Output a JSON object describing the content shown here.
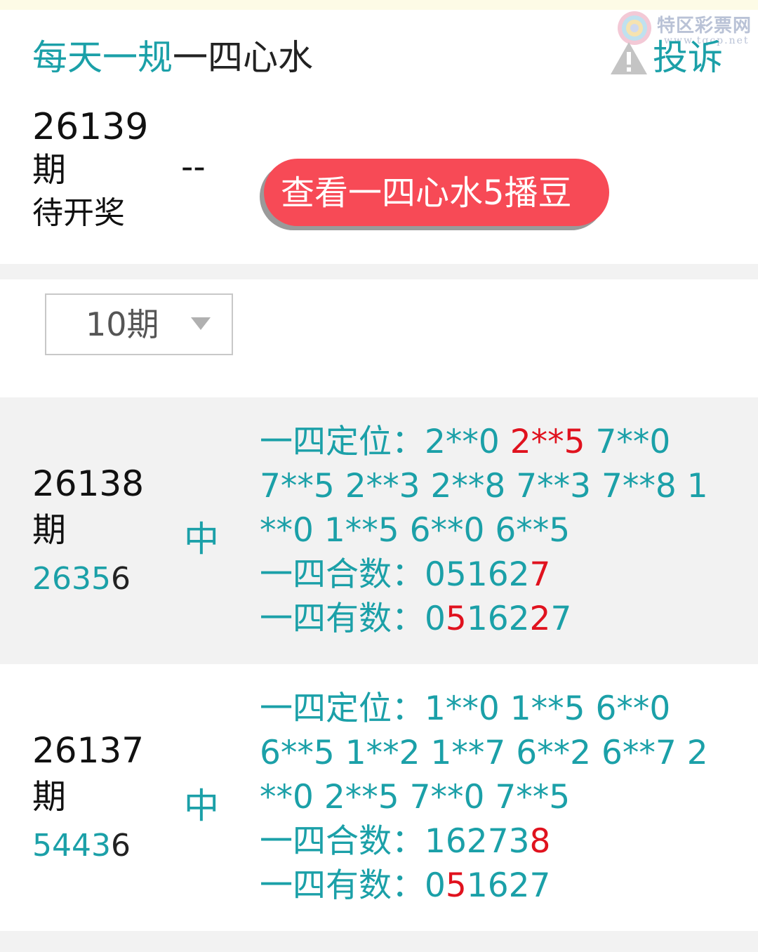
{
  "header": {
    "title_part1": "每天一规",
    "title_part2": "一四心水",
    "report_label": "投诉"
  },
  "watermark": {
    "name": "特区彩票网",
    "url": "www.tqcp.net"
  },
  "current": {
    "issue": "26139",
    "issue_unit": "期",
    "status": "待开奖",
    "result_placeholder": "--",
    "view_button": "查看一四心水5播豆"
  },
  "filter": {
    "selected": "10期"
  },
  "rows": [
    {
      "issue": "26138",
      "unit": "期",
      "result_main": "2635",
      "result_last": "6",
      "hit": "中",
      "dingwei_label": "一四定位：",
      "dingwei_l1_a": "2**0 ",
      "dingwei_l1_hit": "2**5",
      "dingwei_l1_b": " 7**0",
      "dingwei_l2": "7**5 2**3 2**8 7**3 7**8 1",
      "dingwei_l3": "**0 1**5 6**0 6**5",
      "heshu_label": "一四合数：",
      "heshu_a": "05162",
      "heshu_hit": "7",
      "youshu_label": "一四有数：",
      "youshu_p1": "0",
      "youshu_h1": "5",
      "youshu_p2": "162",
      "youshu_h2": "2",
      "youshu_p3": "7"
    },
    {
      "issue": "26137",
      "unit": "期",
      "result_main": "5443",
      "result_last": "6",
      "hit": "中",
      "dingwei_label": "一四定位：",
      "dingwei_l1": "1**0 1**5 6**0",
      "dingwei_l2": "6**5 1**2 1**7 6**2 6**7 2",
      "dingwei_l3": "**0 2**5 7**0 7**5",
      "heshu_label": "一四合数：",
      "heshu_a": "16273",
      "heshu_hit": "8",
      "youshu_label": "一四有数：",
      "youshu_p1": "0",
      "youshu_h1": "5",
      "youshu_p2": "1627"
    }
  ],
  "colors": {
    "teal": "#1ba0a8",
    "red": "#e0121e",
    "button": "#f74a56"
  },
  "icons": {
    "report": "warning-triangle-icon",
    "dropdown": "caret-down-icon",
    "watermark": "swirl-logo-icon"
  }
}
